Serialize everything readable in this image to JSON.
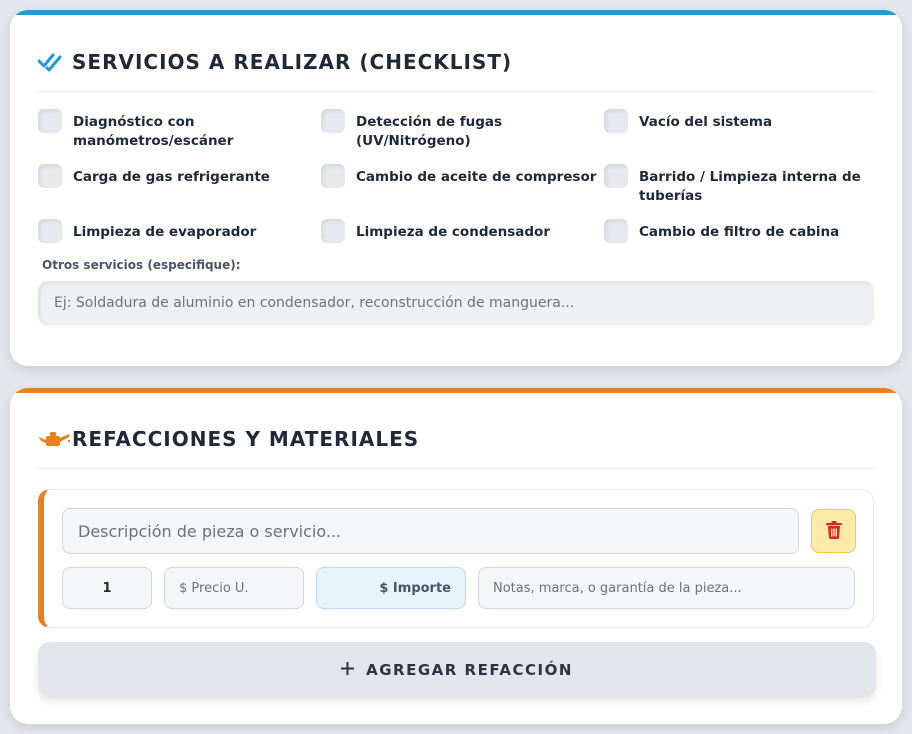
{
  "colors": {
    "services_accent": "#1d9be0",
    "parts_accent": "#e8801f",
    "delete_bg": "#fde9a8",
    "delete_icon": "#dc2626"
  },
  "services": {
    "icon": "double-check-icon",
    "title": "SERVICIOS A REALIZAR (CHECKLIST)",
    "items": [
      {
        "label": "Diagnóstico con manómetros/escáner",
        "checked": false
      },
      {
        "label": "Detección de fugas (UV/Nitrógeno)",
        "checked": false
      },
      {
        "label": "Vacío del sistema",
        "checked": false
      },
      {
        "label": "Carga de gas refrigerante",
        "checked": false
      },
      {
        "label": "Cambio de aceite de compresor",
        "checked": false
      },
      {
        "label": "Barrido / Limpieza interna de tuberías",
        "checked": false
      },
      {
        "label": "Limpieza de evaporador",
        "checked": false
      },
      {
        "label": "Limpieza de condensador",
        "checked": false
      },
      {
        "label": "Cambio de filtro de cabina",
        "checked": false
      }
    ],
    "otros_label": "Otros servicios (especifique):",
    "otros_placeholder": "Ej: Soldadura de aluminio en condensador, reconstrucción de manguera...",
    "otros_value": ""
  },
  "parts": {
    "icon": "oil-can-icon",
    "title": "REFACCIONES Y MATERIALES",
    "rows": [
      {
        "description_placeholder": "Descripción de pieza o servicio...",
        "description_value": "",
        "quantity": "1",
        "price_placeholder": "$ Precio U.",
        "importe_placeholder": "$ Importe",
        "notes_placeholder": "Notas, marca, o garantía de la pieza...",
        "delete_icon": "trash-icon"
      }
    ],
    "add_icon": "plus-icon",
    "add_label": "AGREGAR REFACCIÓN"
  }
}
